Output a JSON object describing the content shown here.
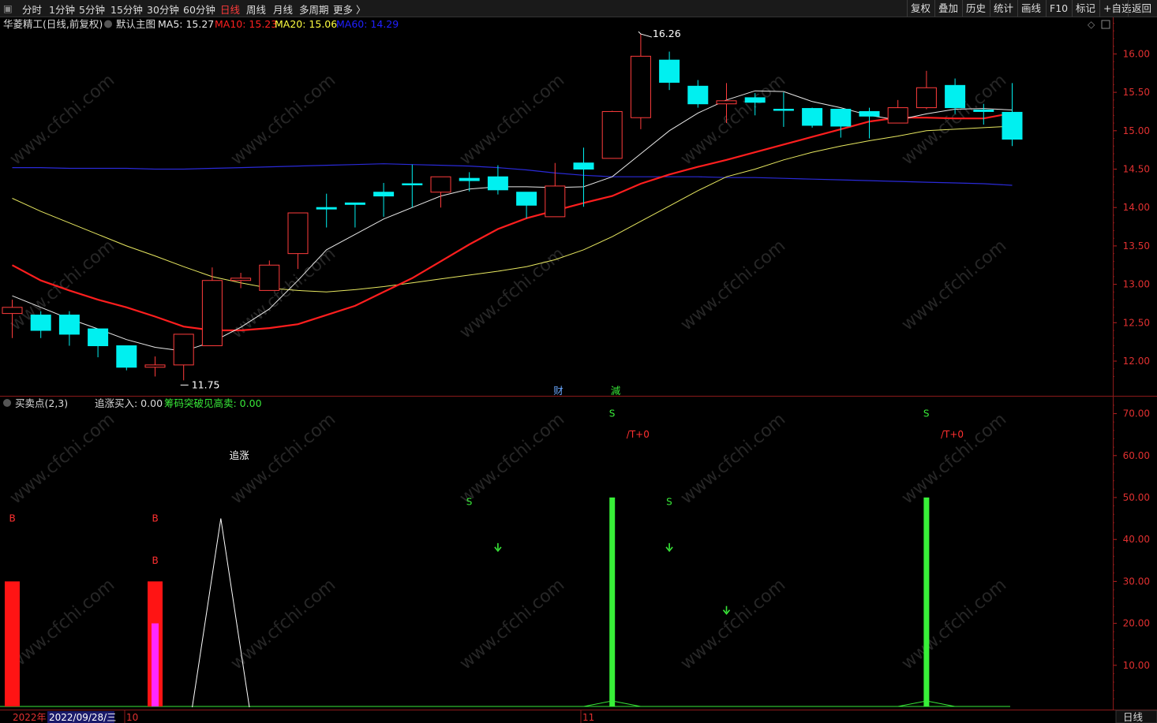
{
  "toolbar": {
    "left_items": [
      {
        "label": "分时"
      },
      {
        "label": "1分钟"
      },
      {
        "label": "5分钟"
      },
      {
        "label": "15分钟"
      },
      {
        "label": "30分钟"
      },
      {
        "label": "60分钟"
      },
      {
        "label": "日线",
        "active": true
      },
      {
        "label": "周线"
      },
      {
        "label": "月线"
      },
      {
        "label": "多周期"
      },
      {
        "label": "更多 〉"
      }
    ],
    "right_items": [
      {
        "label": "复权"
      },
      {
        "label": "叠加"
      },
      {
        "label": "历史"
      },
      {
        "label": "统计"
      },
      {
        "label": "画线"
      },
      {
        "label": "F10"
      },
      {
        "label": "标记"
      },
      {
        "label": "+自选"
      },
      {
        "label": "返回"
      }
    ]
  },
  "main_panel": {
    "stock_title": "华菱精工",
    "mode": "(日线,前复权)",
    "template": "默认主图",
    "ma_legend": [
      {
        "label": "MA5: 15.27",
        "color": "#e8e8e8"
      },
      {
        "label": "MA10: 15.23",
        "color": "#ff2020"
      },
      {
        "label": "MA20: 15.06",
        "color": "#ffff40"
      },
      {
        "label": "MA60: 14.29",
        "color": "#2020ff"
      }
    ],
    "high_label": "16.26",
    "low_label": "11.75",
    "markers": [
      {
        "text": "财",
        "color": "#6aa8ff"
      },
      {
        "text": "減",
        "color": "#38e838"
      }
    ]
  },
  "sub_panel": {
    "indicator": "买卖点(2,3)",
    "value1_label": "追涨买入: 0.00",
    "value2_label": "筹码突破见高卖: 0.00",
    "value2_color": "#38e838",
    "annotations": {
      "zhuizhang": "追涨",
      "b": "B",
      "s": "S",
      "t0": "/T+0"
    }
  },
  "bottom_bar": {
    "year": "2022年",
    "date": "2022/09/28/三",
    "month_ticks": [
      "10",
      "11"
    ],
    "period": "日线"
  },
  "watermark": "www.cfchi.com",
  "chart_data": [
    {
      "type": "candlestick",
      "y_axis_ticks": [
        16.0,
        15.5,
        15.0,
        14.5,
        14.0,
        13.5,
        13.0,
        12.5,
        12.0
      ],
      "ylim": [
        11.5,
        16.5
      ],
      "candles": [
        {
          "o": 12.62,
          "c": 12.7,
          "h": 12.8,
          "l": 12.3
        },
        {
          "o": 12.6,
          "c": 12.4,
          "h": 12.65,
          "l": 12.3
        },
        {
          "o": 12.6,
          "c": 12.35,
          "h": 12.65,
          "l": 12.2
        },
        {
          "o": 12.42,
          "c": 12.2,
          "h": 12.42,
          "l": 12.05
        },
        {
          "o": 12.2,
          "c": 11.92,
          "h": 12.2,
          "l": 11.88
        },
        {
          "o": 11.92,
          "c": 11.95,
          "h": 12.06,
          "l": 11.8
        },
        {
          "o": 11.95,
          "c": 12.35,
          "h": 12.35,
          "l": 11.75
        },
        {
          "o": 12.2,
          "c": 13.05,
          "h": 13.22,
          "l": 12.2
        },
        {
          "o": 13.05,
          "c": 13.08,
          "h": 13.15,
          "l": 12.95
        },
        {
          "o": 12.92,
          "c": 13.25,
          "h": 13.31,
          "l": 12.92
        },
        {
          "o": 13.4,
          "c": 13.93,
          "h": 13.93,
          "l": 13.2
        },
        {
          "o": 14.0,
          "c": 13.98,
          "h": 14.18,
          "l": 13.74
        },
        {
          "o": 14.06,
          "c": 14.04,
          "h": 14.06,
          "l": 13.74
        },
        {
          "o": 14.2,
          "c": 14.15,
          "h": 14.32,
          "l": 13.88
        },
        {
          "o": 14.31,
          "c": 14.3,
          "h": 14.56,
          "l": 14.0
        },
        {
          "o": 14.2,
          "c": 14.4,
          "h": 14.4,
          "l": 14.0
        },
        {
          "o": 14.38,
          "c": 14.35,
          "h": 14.46,
          "l": 14.21
        },
        {
          "o": 14.4,
          "c": 14.23,
          "h": 14.55,
          "l": 14.17
        },
        {
          "o": 14.2,
          "c": 14.03,
          "h": 14.2,
          "l": 13.86
        },
        {
          "o": 13.88,
          "c": 14.28,
          "h": 14.58,
          "l": 13.88
        },
        {
          "o": 14.58,
          "c": 14.5,
          "h": 14.78,
          "l": 14.01
        },
        {
          "o": 14.64,
          "c": 15.25,
          "h": 15.26,
          "l": 14.64
        },
        {
          "o": 15.17,
          "c": 15.97,
          "h": 16.26,
          "l": 15.02
        },
        {
          "o": 15.92,
          "c": 15.63,
          "h": 16.03,
          "l": 15.53
        },
        {
          "o": 15.58,
          "c": 15.35,
          "h": 15.66,
          "l": 15.3
        },
        {
          "o": 15.35,
          "c": 15.39,
          "h": 15.62,
          "l": 15.1
        },
        {
          "o": 15.43,
          "c": 15.37,
          "h": 15.49,
          "l": 15.2
        },
        {
          "o": 15.28,
          "c": 15.27,
          "h": 15.5,
          "l": 15.05
        },
        {
          "o": 15.29,
          "c": 15.07,
          "h": 15.3,
          "l": 15.04
        },
        {
          "o": 15.28,
          "c": 15.06,
          "h": 15.28,
          "l": 14.91
        },
        {
          "o": 15.25,
          "c": 15.19,
          "h": 15.3,
          "l": 14.9
        },
        {
          "o": 15.1,
          "c": 15.3,
          "h": 15.4,
          "l": 15.1
        },
        {
          "o": 15.3,
          "c": 15.56,
          "h": 15.78,
          "l": 15.28
        },
        {
          "o": 15.59,
          "c": 15.3,
          "h": 15.68,
          "l": 15.22
        },
        {
          "o": 15.27,
          "c": 15.25,
          "h": 15.35,
          "l": 15.08
        },
        {
          "o": 15.24,
          "c": 14.89,
          "h": 15.62,
          "l": 14.8
        }
      ],
      "ma5": [
        12.85,
        12.7,
        12.55,
        12.42,
        12.28,
        12.18,
        12.13,
        12.25,
        12.44,
        12.68,
        13.05,
        13.45,
        13.65,
        13.85,
        14.0,
        14.15,
        14.24,
        14.27,
        14.27,
        14.26,
        14.27,
        14.4,
        14.7,
        15.0,
        15.23,
        15.4,
        15.52,
        15.51,
        15.38,
        15.3,
        15.2,
        15.14,
        15.22,
        15.28,
        15.29,
        15.27
      ],
      "ma10": [
        13.25,
        13.05,
        12.92,
        12.8,
        12.7,
        12.58,
        12.45,
        12.4,
        12.4,
        12.43,
        12.48,
        12.6,
        12.72,
        12.9,
        13.08,
        13.3,
        13.52,
        13.72,
        13.86,
        13.96,
        14.06,
        14.15,
        14.31,
        14.43,
        14.53,
        14.62,
        14.72,
        14.82,
        14.92,
        15.02,
        15.12,
        15.17,
        15.17,
        15.16,
        15.16,
        15.23
      ],
      "ma20": [
        14.12,
        13.95,
        13.8,
        13.65,
        13.5,
        13.37,
        13.23,
        13.1,
        13.02,
        12.95,
        12.92,
        12.9,
        12.93,
        12.97,
        13.02,
        13.07,
        13.12,
        13.17,
        13.23,
        13.32,
        13.45,
        13.62,
        13.82,
        14.02,
        14.22,
        14.4,
        14.5,
        14.62,
        14.72,
        14.8,
        14.87,
        14.93,
        15.0,
        15.02,
        15.04,
        15.06
      ],
      "ma60": [
        14.52,
        14.52,
        14.51,
        14.51,
        14.51,
        14.5,
        14.5,
        14.51,
        14.52,
        14.53,
        14.54,
        14.55,
        14.56,
        14.57,
        14.56,
        14.55,
        14.54,
        14.52,
        14.49,
        14.45,
        14.42,
        14.4,
        14.4,
        14.4,
        14.4,
        14.39,
        14.39,
        14.38,
        14.37,
        14.36,
        14.35,
        14.34,
        14.33,
        14.32,
        14.31,
        14.29
      ]
    },
    {
      "type": "bar",
      "name": "买卖点(2,3)",
      "y_axis_ticks": [
        70,
        60,
        50,
        40,
        30,
        20,
        10
      ],
      "ylim": [
        0,
        70
      ],
      "red_bars": [
        {
          "index": 0,
          "value": 30
        },
        {
          "index": 5,
          "value": 30
        }
      ],
      "magenta_bars": [
        {
          "index": 5,
          "value": 20
        }
      ],
      "green_bars": [
        {
          "index": 21,
          "value": 50
        },
        {
          "index": 32,
          "value": 50
        }
      ],
      "white_line": [
        {
          "index": 6.3,
          "value": 0
        },
        {
          "index": 7.3,
          "value": 45
        },
        {
          "index": 8.3,
          "value": 0
        }
      ],
      "b_marks": [
        {
          "index": 0,
          "value": 45
        },
        {
          "index": 5,
          "value": 45
        },
        {
          "index": 5,
          "value": 35
        }
      ],
      "s_marks": [
        {
          "index": 16,
          "value": 49
        },
        {
          "index": 23,
          "value": 49
        },
        {
          "index": 21,
          "value": 70
        },
        {
          "index": 32,
          "value": 70
        }
      ],
      "t0_marks": [
        {
          "index": 21.5,
          "value": 65
        },
        {
          "index": 32.5,
          "value": 65
        }
      ],
      "down_arrows": [
        {
          "index": 17,
          "value": 38
        },
        {
          "index": 23,
          "value": 38
        },
        {
          "index": 25,
          "value": 23
        }
      ],
      "zhuizhang_mark": {
        "index": 7.6,
        "value": 60
      }
    }
  ]
}
